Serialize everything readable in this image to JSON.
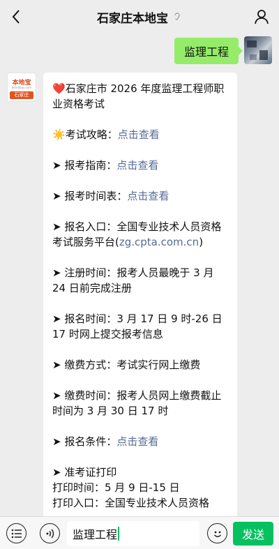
{
  "header": {
    "title": "石家庄本地宝",
    "back_icon": "chevron-left-icon",
    "profile_icon": "person-icon"
  },
  "outgoing": {
    "text": "监理工程"
  },
  "bot": {
    "avatar": {
      "top": "本地宝",
      "mid": "bendibao.com",
      "bar": "石家庄"
    },
    "message": {
      "title_icon": "❤️",
      "title": "石家庄市 2026 年度监理工程师职业资格考试",
      "items": [
        {
          "icon": "☀️",
          "label": "考试攻略：",
          "link": "点击查看"
        },
        {
          "icon": "➤",
          "label": "报考指南：",
          "link": "点击查看"
        },
        {
          "icon": "➤",
          "label": "报考时间表：",
          "link": "点击查看"
        },
        {
          "icon": "➤",
          "label": "报名入口：全国专业技术人员资格考试服务平台(",
          "link": "zg.cpta.com.cn",
          "suffix": ")"
        },
        {
          "icon": "➤",
          "label": "注册时间：报考人员最晚于 3 月 24 日前完成注册"
        },
        {
          "icon": "➤",
          "label": "报名时间：3 月 17 日 9 时-26 日 17 时网上提交报考信息"
        },
        {
          "icon": "➤",
          "label": "缴费方式：考试实行网上缴费"
        },
        {
          "icon": "➤",
          "label": "缴费时间：报考人员网上缴费截止时间为 3 月 30 日 17 时"
        },
        {
          "icon": "➤",
          "label": "报名条件：",
          "link": "点击查看"
        },
        {
          "icon": "➤",
          "label": "准考证打印",
          "lines": [
            "打印时间：5 月 9 日-15 日",
            "打印入口：全国专业技术人员资格"
          ]
        }
      ]
    }
  },
  "input": {
    "list_icon": "list-icon",
    "voice_icon": "voice-icon",
    "value": "监理工程",
    "emoji_icon": "emoji-icon",
    "send_label": "发送"
  },
  "colors": {
    "background": "#ededed",
    "outgoing_bubble": "#95ec69",
    "link": "#576b95",
    "send_button": "#07c160"
  }
}
